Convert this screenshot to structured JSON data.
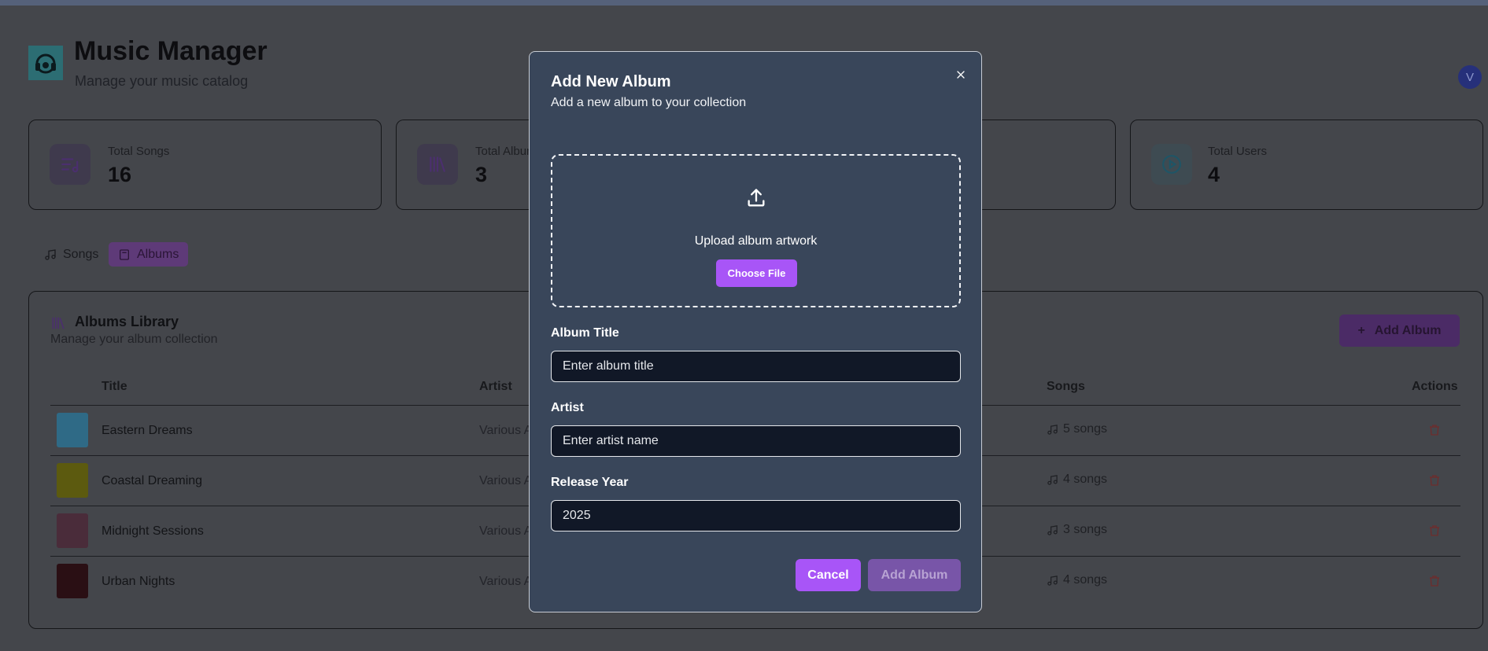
{
  "header": {
    "title": "Music Manager",
    "subtitle": "Manage your music catalog",
    "avatar_initial": "V"
  },
  "stats": [
    {
      "label": "Total Songs",
      "value": "16",
      "icon": "music-list-icon"
    },
    {
      "label": "Total Albums",
      "value": "3",
      "icon": "library-icon"
    },
    {
      "label": "Total Users",
      "value": "4",
      "icon": "play-circle-icon"
    }
  ],
  "tabs": [
    {
      "label": "Songs",
      "icon": "music-note-icon",
      "active": false
    },
    {
      "label": "Albums",
      "icon": "album-icon",
      "active": true
    }
  ],
  "library": {
    "title": "Albums Library",
    "subtitle": "Manage your album collection",
    "add_button": "Add Album",
    "columns": {
      "title": "Title",
      "artist": "Artist",
      "songs": "Songs",
      "actions": "Actions"
    },
    "rows": [
      {
        "title": "Eastern Dreams",
        "artist": "Various A",
        "songs": "5 songs",
        "cover_color": "#2f6a86"
      },
      {
        "title": "Coastal Dreaming",
        "artist": "Various A",
        "songs": "4 songs",
        "cover_color": "#5c5a0f"
      },
      {
        "title": "Midnight Sessions",
        "artist": "Various A",
        "songs": "3 songs",
        "cover_color": "#4a2c3a"
      },
      {
        "title": "Urban Nights",
        "artist": "Various A",
        "songs": "4 songs",
        "cover_color": "#2a0f14"
      }
    ]
  },
  "modal": {
    "title": "Add New Album",
    "subtitle": "Add a new album to your collection",
    "upload_text": "Upload album artwork",
    "choose_file": "Choose File",
    "fields": {
      "album_title": {
        "label": "Album Title",
        "placeholder": "Enter album title",
        "value": ""
      },
      "artist": {
        "label": "Artist",
        "placeholder": "Enter artist name",
        "value": ""
      },
      "release_year": {
        "label": "Release Year",
        "value": "2025"
      }
    },
    "cancel": "Cancel",
    "submit": "Add Album"
  },
  "colors": {
    "accent": "#a855f7",
    "modal_bg": "#39465a",
    "input_bg": "#111827",
    "danger": "#7a2a2a"
  }
}
